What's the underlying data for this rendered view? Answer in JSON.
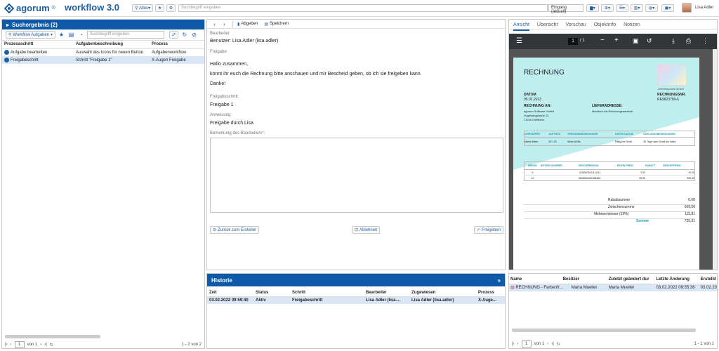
{
  "header": {
    "logo": "agorum",
    "logo_sup": "®",
    "app_title": "workflow 3.0",
    "filter_label": "Alles",
    "search_placeholder": "Suchbegriff eingeben",
    "inbox_label": "Eingang (aktuell)",
    "user_name": "Lisa Adler"
  },
  "left": {
    "title": "Suchergebnis (2)",
    "workflow_button": "Workflow Aufgaben",
    "search_placeholder": "Suchbegriff eingeben",
    "columns": [
      "Prozessschritt",
      "Aufgabenbeschreibung",
      "Prozess"
    ],
    "rows": [
      [
        "Aufgabe bearbeiten",
        "Auswahl des Icons für neuen Button",
        "Aufgabenworkflow"
      ],
      [
        "Freigabeschritt",
        "Schritt \"Freigabe 1\"",
        "X-Augen Freigabe"
      ]
    ],
    "pager": {
      "page": "1",
      "of_label": "von 1",
      "summary": "1 - 2 von 2"
    }
  },
  "center": {
    "toolbar": {
      "submit": "Abgeben",
      "save": "Speichern"
    },
    "editor_label": "Bearbeiter:",
    "editor_value": "Benutzer: Lisa Adler (lisa.adler)",
    "request_label": "Freigabe:",
    "message_greeting": "Hallo zusammen,",
    "message_body": "könnt ihr euch die Rechnung bitte anschauen und mir Bescheid geben, ob ich sie freigeben kann.",
    "message_thanks": "Danke!",
    "step_label": "Freigabeschritt:",
    "step_value": "Freigabe 1",
    "instruction_label": "Anweisung:",
    "instruction_value": "Freigabe durch Lisa",
    "comment_label": "Bemerkung des Bearbeiters*:",
    "buttons": {
      "back": "Zurück zum Ersteller",
      "reject": "Ablehnen",
      "approve": "Freigeben"
    }
  },
  "history": {
    "title": "Historie",
    "columns": [
      "Zeit",
      "Status",
      "Schritt",
      "Bearbeiter",
      "Zugewiesen",
      "Prozess"
    ],
    "rows": [
      [
        "03.02.2022 09:59:40",
        "Aktiv",
        "Freigabeschritt",
        "Lisa Adler (lisa....",
        "Lisa Adler (lisa.adler)",
        "X-Auge..."
      ]
    ]
  },
  "right": {
    "tabs": [
      "Ansicht",
      "Übersicht",
      "Vorschau",
      "Objektinfo",
      "Notizen"
    ],
    "pdf_page": "1",
    "pdf_total": "/ 1",
    "invoice": {
      "title": "RECHNUNG",
      "logo_caption": "Zeichenpunkt GmbH",
      "date_label": "DATUM",
      "date": "05.02.2022",
      "number_label": "RECHNUNGSNR.",
      "number": "RE9823789-6",
      "bill_to_label": "RECHNUNG AN:",
      "bill_to": [
        "agorum Software GmbH",
        "Vogelsangstraße 22",
        "73760 Ostfildern"
      ],
      "ship_label": "LIEFERADRESSE:",
      "ship_to": "Identisch mit Rechnungsadresse",
      "info_headers": [
        "VERKÄUFER",
        "AUFTRAG",
        "VERSANDBEDINGUNGEN",
        "LIEFER DATUM",
        "ZAHLUNGSBEDINGUNGEN"
      ],
      "info_values": [
        "Martin Meier",
        "AF 123",
        "Siehe AGBs",
        "Fällig bei Erhalt",
        "30 Tage nach Erhalt der Ware"
      ],
      "item_headers": [
        "MENGE",
        "ARTIKELNUMMER",
        "BESCHREIBUNG",
        "EINZELPREIS",
        "RABATT",
        "GESAMTPREIS"
      ],
      "items": [
        [
          "5",
          "",
          "12365478111111111",
          "2,00",
          "",
          "10,00"
        ],
        [
          "10",
          "",
          "9845653484384565",
          "59,95",
          "",
          "599,50"
        ]
      ],
      "totals": [
        [
          "Rabattsumme",
          "0,00"
        ],
        [
          "Zwischensumme",
          "609,50"
        ],
        [
          "Mehrwertsteuer (19%)",
          "115,81"
        ],
        [
          "Summe",
          "725,31"
        ]
      ]
    },
    "files": {
      "columns": [
        "Name",
        "Besitzer",
        "Zuletzt geändert dur",
        "Letzte Änderung",
        "Erstelld"
      ],
      "rows": [
        [
          "RECHNUNG - Farbenfr...",
          "Marta Mueller",
          "Marta Mueller",
          "03.02.2022 09:55:36",
          "03.02.20"
        ]
      ]
    },
    "pager": {
      "page": "1",
      "of_label": "von 1",
      "summary": "1 - 1 von 1"
    }
  },
  "colors": {
    "brand_blue": "#0f5aa8",
    "accent_cyan": "#bfeeee"
  }
}
